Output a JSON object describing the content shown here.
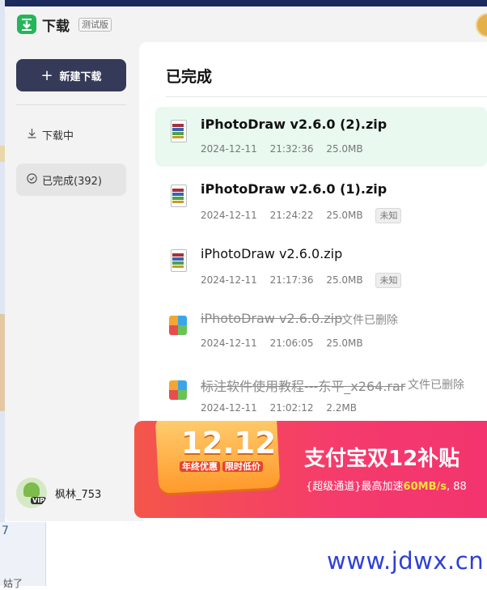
{
  "app": {
    "title": "下载",
    "badge": "测试版"
  },
  "sidebar": {
    "new_download": "新建下载",
    "items": [
      {
        "label": "下载中",
        "icon": "download-arrow-icon"
      },
      {
        "label": "已完成(392)",
        "icon": "check-circle-icon"
      }
    ],
    "user": {
      "name": "枫林_753",
      "badge": "VIP"
    }
  },
  "main": {
    "title": "已完成",
    "files": [
      {
        "name": "iPhotoDraw v2.6.0 (2).zip",
        "date": "2024-12-11",
        "time": "21:32:36",
        "size": "25.0MB",
        "tag": "",
        "deleted": ""
      },
      {
        "name": "iPhotoDraw v2.6.0 (1).zip",
        "date": "2024-12-11",
        "time": "21:24:22",
        "size": "25.0MB",
        "tag": "未知",
        "deleted": ""
      },
      {
        "name": "iPhotoDraw v2.6.0.zip",
        "date": "2024-12-11",
        "time": "21:17:36",
        "size": "25.0MB",
        "tag": "未知",
        "deleted": ""
      },
      {
        "name": "iPhotoDraw v2.6.0.zip",
        "date": "2024-12-11",
        "time": "21:06:05",
        "size": "25.0MB",
        "tag": "",
        "deleted": "文件已删除"
      },
      {
        "name": "标注软件使用教程---东平_x264.rar",
        "date": "2024-12-11",
        "time": "21:02:12",
        "size": "2.2MB",
        "tag": "",
        "deleted": "文件已删除"
      }
    ]
  },
  "ad": {
    "number": "12.12",
    "sub1": "年终优惠",
    "sub2": "限时低价",
    "headline": "支付宝双12补贴",
    "line_prefix": "{超级通道}最高加速",
    "line_speed": "60MB/s",
    "line_suffix": ", 88"
  },
  "background": {
    "num": "7",
    "bottom_text": "姑了"
  },
  "watermark": "www.jdwx.cn",
  "colors": {
    "accent": "#27b55b",
    "primary_button": "#353a58",
    "selected_row": "#e9f9ef"
  }
}
